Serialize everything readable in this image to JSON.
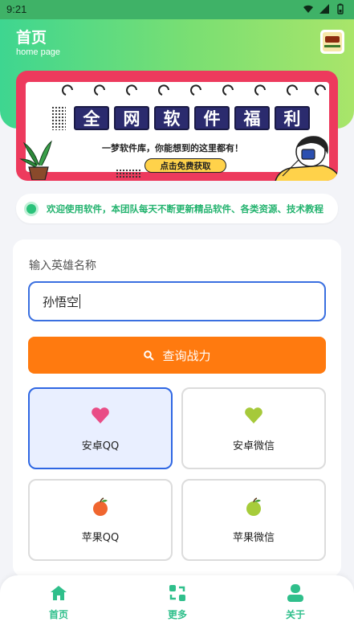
{
  "status_bar": {
    "time": "9:21"
  },
  "header": {
    "title": "首页",
    "subtitle": "home page"
  },
  "banner": {
    "title_chars": [
      "全",
      "网",
      "软",
      "件",
      "福",
      "利"
    ],
    "subtitle": "一梦软件库，你能想到的这里都有！",
    "button_label": "点击免费获取"
  },
  "notice": {
    "text": "欢迎使用软件，本团队每天不断更新精品软件、各类资源、技术教程"
  },
  "form": {
    "label": "输入英雄名称",
    "input_value": "孙悟空",
    "query_button": "查询战力"
  },
  "options": [
    {
      "label": "安卓QQ",
      "icon": "heart-icon",
      "selected": true
    },
    {
      "label": "安卓微信",
      "icon": "heart-icon",
      "selected": false
    },
    {
      "label": "苹果QQ",
      "icon": "apple-icon",
      "selected": false
    },
    {
      "label": "苹果微信",
      "icon": "apple-icon",
      "selected": false
    }
  ],
  "bottom_nav": [
    {
      "label": "首页",
      "icon": "home-icon"
    },
    {
      "label": "更多",
      "icon": "refresh-icon"
    },
    {
      "label": "关于",
      "icon": "user-icon"
    }
  ],
  "colors": {
    "accent_green": "#2fbf8b",
    "query_button": "#ff7a0f",
    "selected_border": "#2f67e3",
    "banner_red": "#ed3a5d"
  }
}
